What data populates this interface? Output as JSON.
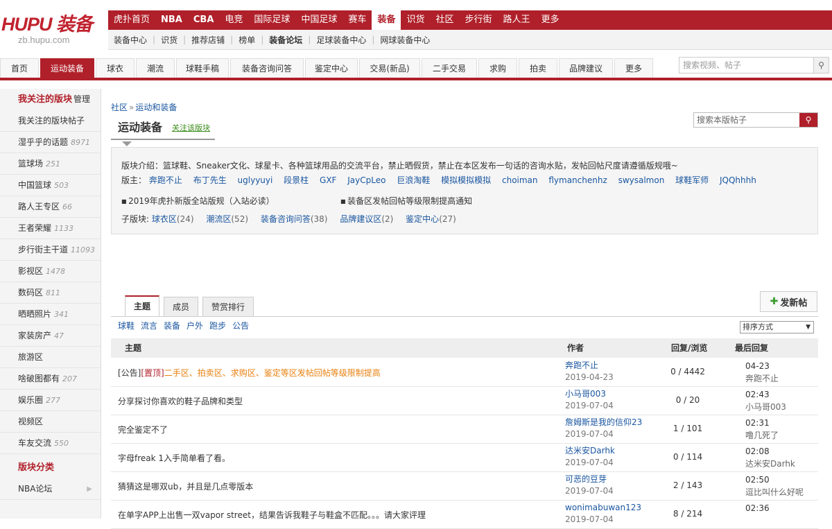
{
  "logo": {
    "brand": "HUPU 装备",
    "url": "zb.hupu.com"
  },
  "topnav": [
    "虎扑首页",
    "NBA",
    "CBA",
    "电竞",
    "国际足球",
    "中国足球",
    "赛车",
    "装备",
    "识货",
    "社区",
    "步行街",
    "路人王",
    "更多"
  ],
  "subnav": [
    "装备中心",
    "识货",
    "推荐店铺",
    "榜单",
    "装备论坛",
    "足球装备中心",
    "网球装备中心"
  ],
  "mainnav": [
    "首页",
    "运动装备",
    "球衣",
    "潮流",
    "球鞋手稿",
    "装备咨询问答",
    "鉴定中心",
    "交易(新品)",
    "二手交易",
    "求购",
    "拍卖",
    "品牌建议",
    "更多"
  ],
  "global_search": {
    "placeholder": "搜索视频、帖子"
  },
  "sidebar": {
    "header": "我关注的版块",
    "manage": "管理",
    "items": [
      {
        "label": "我关注的版块帖子",
        "count": ""
      },
      {
        "label": "湿乎乎的话题",
        "count": "8971"
      },
      {
        "label": "篮球场",
        "count": "251"
      },
      {
        "label": "中国篮球",
        "count": "503"
      },
      {
        "label": "路人王专区",
        "count": "66"
      },
      {
        "label": "王者荣耀",
        "count": "1133"
      },
      {
        "label": "步行街主干道",
        "count": "11093"
      },
      {
        "label": "影视区",
        "count": "1478"
      },
      {
        "label": "数码区",
        "count": "811"
      },
      {
        "label": "晒晒照片",
        "count": "341"
      },
      {
        "label": "家装房产",
        "count": "47"
      },
      {
        "label": "旅游区",
        "count": ""
      },
      {
        "label": "啥破图都有",
        "count": "207"
      },
      {
        "label": "娱乐圈",
        "count": "277"
      },
      {
        "label": "视频区",
        "count": ""
      },
      {
        "label": "车友交流",
        "count": "550"
      }
    ],
    "category_header": "版块分类",
    "categories": [
      {
        "label": "NBA论坛"
      }
    ]
  },
  "breadcrumb": {
    "home": "社区",
    "sep": "»",
    "current": "运动和装备"
  },
  "forum": {
    "title": "运动装备",
    "follow": "关注该版块"
  },
  "forum_search": {
    "placeholder": "搜索本版帖子"
  },
  "info": {
    "intro": "版块介绍：篮球鞋、Sneaker文化、球星卡、各种篮球用品的交流平台，禁止晒假货，禁止在本区发布一句话的咨询水贴，发帖回帖尺度请遵循版规哦~",
    "moderators_label": "版主：",
    "moderators": [
      "奔跑不止",
      "布丁先生",
      "uglyyuyi",
      "段景柱",
      "GXF",
      "JayCpLeo",
      "巨浪淘鞋",
      "模拟模拟模拟",
      "choiman",
      "flymanchenhz",
      "swysalmon",
      "球鞋军师",
      "JQQhhhh"
    ],
    "rules": [
      "2019年虎扑新版全站版规（入站必读）",
      "装备区发帖回帖等级限制提高通知"
    ],
    "subforums_label": "子版块:",
    "subforums": [
      {
        "name": "球衣区",
        "count": "(24)"
      },
      {
        "name": "潮流区",
        "count": "(52)"
      },
      {
        "name": "装备咨询问答",
        "count": "(38)"
      },
      {
        "name": "品牌建议区",
        "count": "(2)"
      },
      {
        "name": "鉴定中心",
        "count": "(27)"
      }
    ]
  },
  "tabs": [
    "主题",
    "成员",
    "赞赏排行"
  ],
  "new_post": "发新帖",
  "filters": [
    "球鞋",
    "流言",
    "装备",
    "户外",
    "跑步",
    "公告"
  ],
  "sort": "排序方式",
  "table": {
    "headers": {
      "topic": "主题",
      "author": "作者",
      "replies": "回复/浏览",
      "last": "最后回复"
    },
    "rows": [
      {
        "tag": "[公告]",
        "pin": "[置顶]",
        "title": "二手区、拍卖区、求购区、鉴定等区发帖回帖等级限制提高",
        "author": "奔跑不止",
        "date": "2019-04-23",
        "stats": "0 / 4442",
        "last_time": "04-23",
        "last_user": "奔跑不止"
      },
      {
        "tag": "",
        "pin": "",
        "title": "分享探讨你喜欢的鞋子品牌和类型",
        "author": "小马哥003",
        "date": "2019-07-04",
        "stats": "0 / 20",
        "last_time": "02:43",
        "last_user": "小马哥003"
      },
      {
        "tag": "",
        "pin": "",
        "title": "完全鉴定不了",
        "author": "詹姆斯是我的信仰23",
        "date": "2019-07-04",
        "stats": "1 / 101",
        "last_time": "02:31",
        "last_user": "噜几死了"
      },
      {
        "tag": "",
        "pin": "",
        "title": "字母freak 1入手简单看了看。",
        "author": "达米安Darhk",
        "date": "2019-07-04",
        "stats": "0 / 114",
        "last_time": "02:08",
        "last_user": "达米安Darhk"
      },
      {
        "tag": "",
        "pin": "",
        "title": "猜猜这是哪双ub，并且是几点零版本",
        "author": "可恶的豆芽",
        "date": "2019-07-04",
        "stats": "2 / 143",
        "last_time": "02:50",
        "last_user": "逗比叫什么好呢"
      },
      {
        "tag": "",
        "pin": "",
        "title": "在单字APP上出售一双vapor street，结果告诉我鞋子与鞋盒不匹配。。。请大家评理",
        "author": "wonimabuwan123",
        "date": "2019-07-04",
        "stats": "8 / 214",
        "last_time": "02:36",
        "last_user": ""
      }
    ]
  }
}
